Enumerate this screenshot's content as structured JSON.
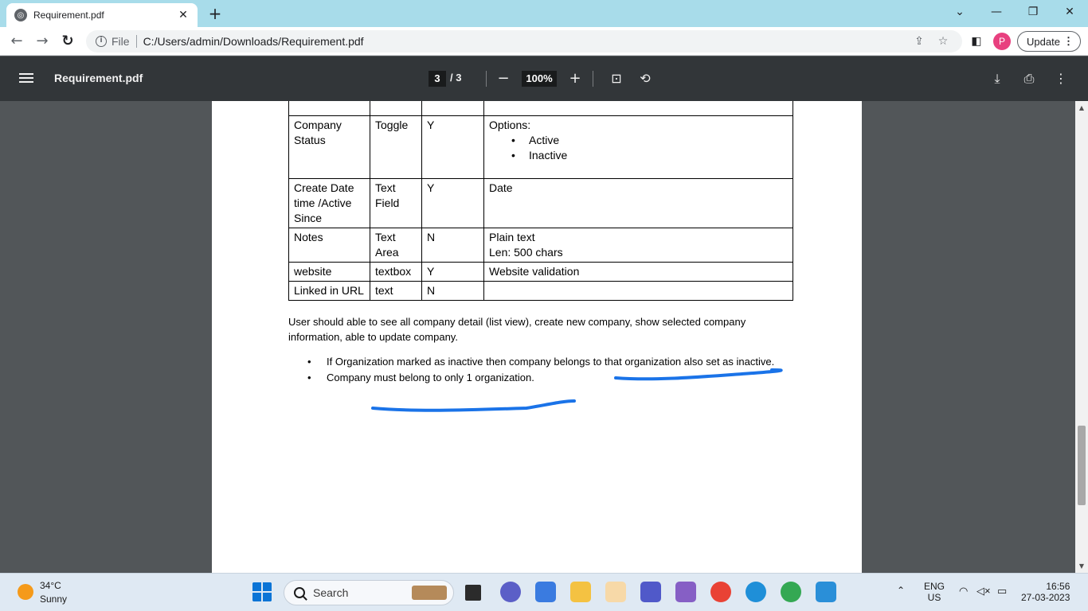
{
  "browser": {
    "tab_title": "Requirement.pdf",
    "tab_close": "✕",
    "new_tab": "+",
    "scheme": "File",
    "url": "C:/Users/admin/Downloads/Requirement.pdf",
    "profile_initial": "P",
    "update_label": "Update"
  },
  "pdf_toolbar": {
    "title": "Requirement.pdf",
    "current_page": "3",
    "page_total": "/ 3",
    "zoom": "100%"
  },
  "table": {
    "rows": [
      {
        "field": "Company Status",
        "type": "Toggle",
        "required": "Y",
        "notes": "Options:",
        "options": [
          "Active",
          "Inactive"
        ]
      },
      {
        "field": "Create Date time /Active Since",
        "type": "Text Field",
        "required": "Y",
        "notes": "Date"
      },
      {
        "field": "Notes",
        "type": "Text Area",
        "required": "N",
        "notes": "Plain text",
        "notes2": "Len: 500 chars"
      },
      {
        "field": "website",
        "type": "textbox",
        "required": "Y",
        "notes": "Website validation"
      },
      {
        "field": "Linked in URL",
        "type": "text",
        "required": "N",
        "notes": ""
      }
    ]
  },
  "body_text": {
    "paragraph": "User should able to see all company detail (list view), create new company, show selected company information, able to update company.",
    "bullets": [
      "If Organization marked as inactive then company belongs to that organization also set as inactive.",
      "Company must belong to only 1 organization."
    ],
    "highlight_color": "#1a73e8"
  },
  "taskbar": {
    "temperature": "34°C",
    "condition": "Sunny",
    "search_label": "Search",
    "language": "ENG",
    "region": "US",
    "time": "16:56",
    "date": "27-03-2023"
  },
  "icons": {
    "back": "back-arrow-icon",
    "forward": "forward-arrow-icon",
    "reload": "reload-icon",
    "share": "share-icon",
    "bookmark": "star-icon",
    "sidepanel": "side-panel-icon",
    "download": "download-icon",
    "print": "print-icon",
    "more": "more-vert-icon",
    "fit": "fit-page-icon",
    "rotate": "rotate-icon"
  }
}
